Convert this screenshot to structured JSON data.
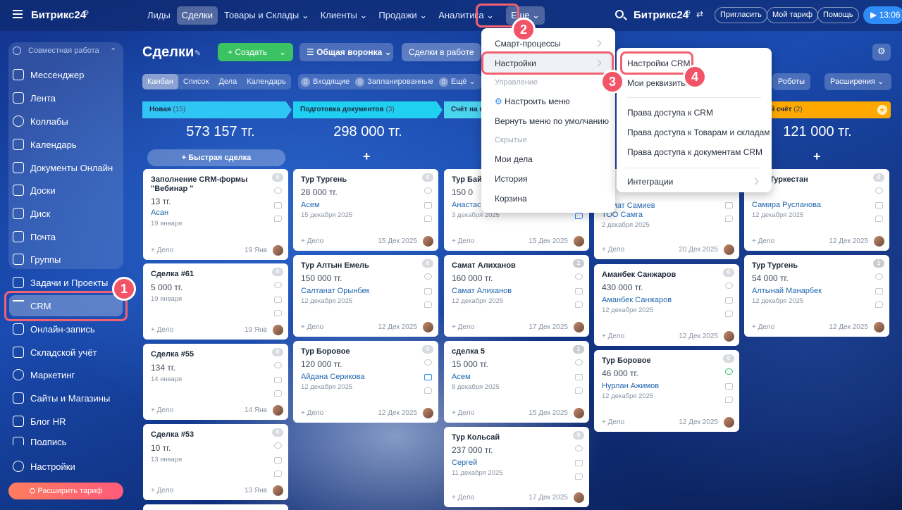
{
  "topbar": {
    "logo": "Битрикс24",
    "nav": [
      "Лиды",
      "Сделки",
      "Товары и Склады",
      "Клиенты",
      "Продажи",
      "Аналитика"
    ],
    "more": "Еще",
    "logo2": "Битрикс24",
    "invite": "Пригласить",
    "plan": "Мой тариф",
    "help": "Помощь",
    "clock": "13:06"
  },
  "sidebar": {
    "group_title": "Совместная работа",
    "items": [
      "Мессенджер",
      "Лента",
      "Коллабы",
      "Календарь",
      "Документы Онлайн",
      "Доски",
      "Диск",
      "Почта",
      "Группы",
      "Задачи и Проекты",
      "CRM",
      "Онлайн-запись",
      "Складской учёт",
      "Маркетинг",
      "Сайты и Магазины",
      "Блог HR",
      "Подпись",
      "Настройки"
    ],
    "upgrade": "Расширить тариф"
  },
  "toolbar": {
    "title": "Сделки",
    "create": "Создать",
    "funnel": "Общая воронка",
    "filter": "Сделки в работе",
    "views": [
      "Канбан",
      "Список",
      "Дела",
      "Календарь"
    ],
    "counters": [
      {
        "n": "0",
        "label": "Входящие"
      },
      {
        "n": "0",
        "label": "Запланированные"
      },
      {
        "n": "0",
        "label": "Ещё"
      }
    ],
    "robots": "Роботы",
    "extensions": "Расширения"
  },
  "columns": [
    {
      "name": "Новая",
      "count": "(15)",
      "sum": "573 157  тг.",
      "color": "#2fc6f6"
    },
    {
      "name": "Подготовка документов",
      "count": "(3)",
      "sum": "298 000  тг.",
      "color": "#1fd0f0"
    },
    {
      "name": "Счёт на п",
      "count": "",
      "sum": "",
      "color": "#4bd4ee"
    },
    {
      "name": "",
      "count": "",
      "sum": "",
      "color": "#5edcf0"
    },
    {
      "name": "льный счёт",
      "count": "(2)",
      "sum": "121 000  тг.",
      "color": "#ffa900"
    }
  ],
  "quick_deal": "Быстрая сделка",
  "cards": {
    "c1": [
      {
        "title": "Заполнение CRM-формы \"Вебинар \"",
        "price": "13 тг.",
        "contact": "Асан",
        "date": "19 января",
        "add": "+ Дело",
        "when": "19 Янв",
        "num": "0"
      },
      {
        "title": "Сделка #61",
        "price": "5 000 тг.",
        "contact": "",
        "date": "19 января",
        "add": "+ Дело",
        "when": "19 Янв",
        "num": "0"
      },
      {
        "title": "Сделка #55",
        "price": "134 тг.",
        "contact": "",
        "date": "14 января",
        "add": "+ Дело",
        "when": "14 Янв",
        "num": "0"
      },
      {
        "title": "Сделка #53",
        "price": "10 тг.",
        "contact": "",
        "date": "13 января",
        "add": "+ Дело",
        "when": "13 Янв",
        "num": "0"
      }
    ],
    "c2": [
      {
        "title": "Тур Тургень",
        "price": "28 000 тг.",
        "contact": "Асем",
        "date": "15 декабря 2025",
        "add": "+ Дело",
        "when": "15 Дек 2025",
        "num": "0"
      },
      {
        "title": "Тур Алтын Емель",
        "price": "150 000 тг.",
        "contact": "Салтанат Орынбек",
        "date": "12 декабря 2025",
        "add": "+ Дело",
        "when": "12 Дек 2025",
        "num": "0"
      },
      {
        "title": "Тур Боровое",
        "price": "120 000 тг.",
        "contact": "Айдана Серикова",
        "date": "12 декабря 2025",
        "add": "+ Дело",
        "when": "12 Дек 2025",
        "num": "0"
      }
    ],
    "c3": [
      {
        "title": "Тур Бай",
        "price": "150 0",
        "contact": "Анастас",
        "date": "3 декабря 2025",
        "add": "+ Дело",
        "when": "15 Дек 2025",
        "num": ""
      },
      {
        "title": "Самат  Алиханов",
        "price": "160 000 тг.",
        "contact": "Самат  Алиханов",
        "date": "12 декабря 2025",
        "add": "+ Дело",
        "when": "17 Дек 2025",
        "num": "2"
      },
      {
        "title": "сделка 5",
        "price": "15 000 тг.",
        "contact": "Асем",
        "date": "8 декабря 2025",
        "add": "+ Дело",
        "when": "15 Дек 2025",
        "num": "1"
      },
      {
        "title": "Тур Кольсай",
        "price": "237 000 тг.",
        "contact": "Сергей",
        "date": "11 декабря 2025",
        "add": "+ Дело",
        "when": "17 Дек 2025",
        "num": "0"
      }
    ],
    "c4": [
      {
        "title": "",
        "price": "",
        "contact": "Самат Самиев",
        "contact2": "ТОО Самга",
        "date": "2 декабря 2025",
        "add": "+ Дело",
        "when": "20 Дек 2025",
        "num": ""
      },
      {
        "title": "Аманбек Санжаров",
        "price": "430 000 тг.",
        "contact": "Аманбек Санжаров",
        "date": "12 декабря 2025",
        "add": "+ Дело",
        "when": "12 Дек 2025",
        "num": "0"
      },
      {
        "title": "Тур Боровое",
        "price": "46 000 тг.",
        "contact": "Нурлан Ажимов",
        "date": "12 декабря 2025",
        "add": "+ Дело",
        "when": "12 Дек 2025",
        "num": "0"
      }
    ],
    "c5": [
      {
        "title": "Туркестан",
        "price": "",
        "contact": "Самира Русланова",
        "date": "12 декабря 2025",
        "add": "+ Дело",
        "when": "12 Дек 2025",
        "num": "0"
      },
      {
        "title": "Тур Тургень",
        "price": "54 000 тг.",
        "contact": "Алтынай Манарбек",
        "date": "12 декабря 2025",
        "add": "+ Дело",
        "when": "12 Дек 2025",
        "num": "1"
      }
    ]
  },
  "more_menu": {
    "items": [
      "Смарт-процессы",
      "Настройки"
    ],
    "section_manage": "Управление",
    "configure": "Настроить меню",
    "reset": "Вернуть меню по умолчанию",
    "section_hidden": "Скрытые",
    "hidden": [
      "Мои дела",
      "История",
      "Корзина"
    ]
  },
  "settings_menu": {
    "crm_settings": "Настройки CRM",
    "requisites": "Мои реквизиты",
    "access": [
      "Права доступа к CRM",
      "Права доступа к Товарам и складам",
      "Права доступа к документам CRM"
    ],
    "integrations": "Интеграции"
  },
  "steps": [
    "1",
    "2",
    "3",
    "4"
  ]
}
